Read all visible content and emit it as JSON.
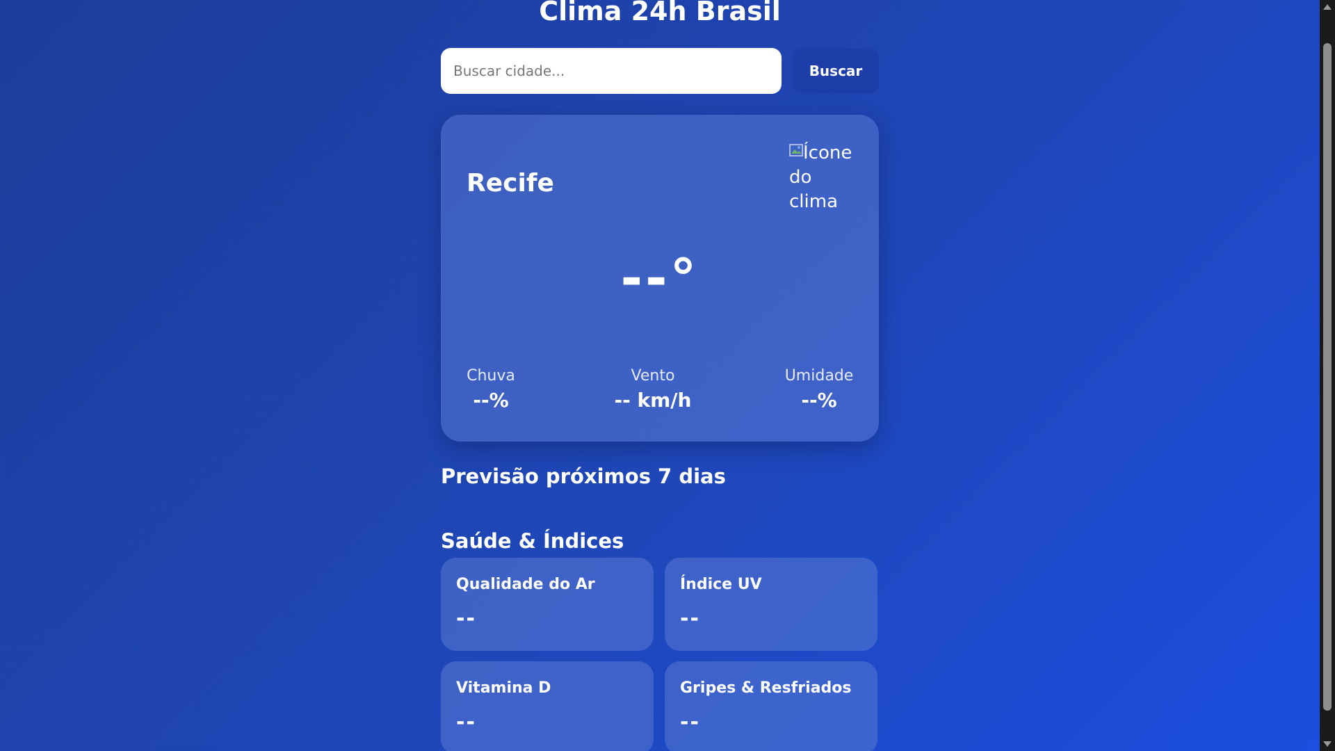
{
  "app": {
    "title": "Clima 24h Brasil"
  },
  "search": {
    "placeholder": "Buscar cidade...",
    "value": "",
    "button_label": "Buscar"
  },
  "current": {
    "city": "Recife",
    "icon_alt": "Ícone do clima",
    "temperature": "--°",
    "stats": {
      "rain": {
        "label": "Chuva",
        "value": "--%"
      },
      "wind": {
        "label": "Vento",
        "value": "-- km/h"
      },
      "humidity": {
        "label": "Umidade",
        "value": "--%"
      }
    }
  },
  "forecast": {
    "title": "Previsão próximos 7 dias"
  },
  "health": {
    "title": "Saúde & Índices",
    "cards": [
      {
        "label": "Qualidade do Ar",
        "value": "--"
      },
      {
        "label": "Índice UV",
        "value": "--"
      },
      {
        "label": "Vitamina D",
        "value": "--"
      },
      {
        "label": "Gripes & Resfriados",
        "value": "--"
      }
    ]
  },
  "colors": {
    "background_start": "#1e3c99",
    "background_end": "#1c4ee0",
    "card": "#5878d2",
    "search_button": "#1d3ea8",
    "text": "#ffffff"
  }
}
